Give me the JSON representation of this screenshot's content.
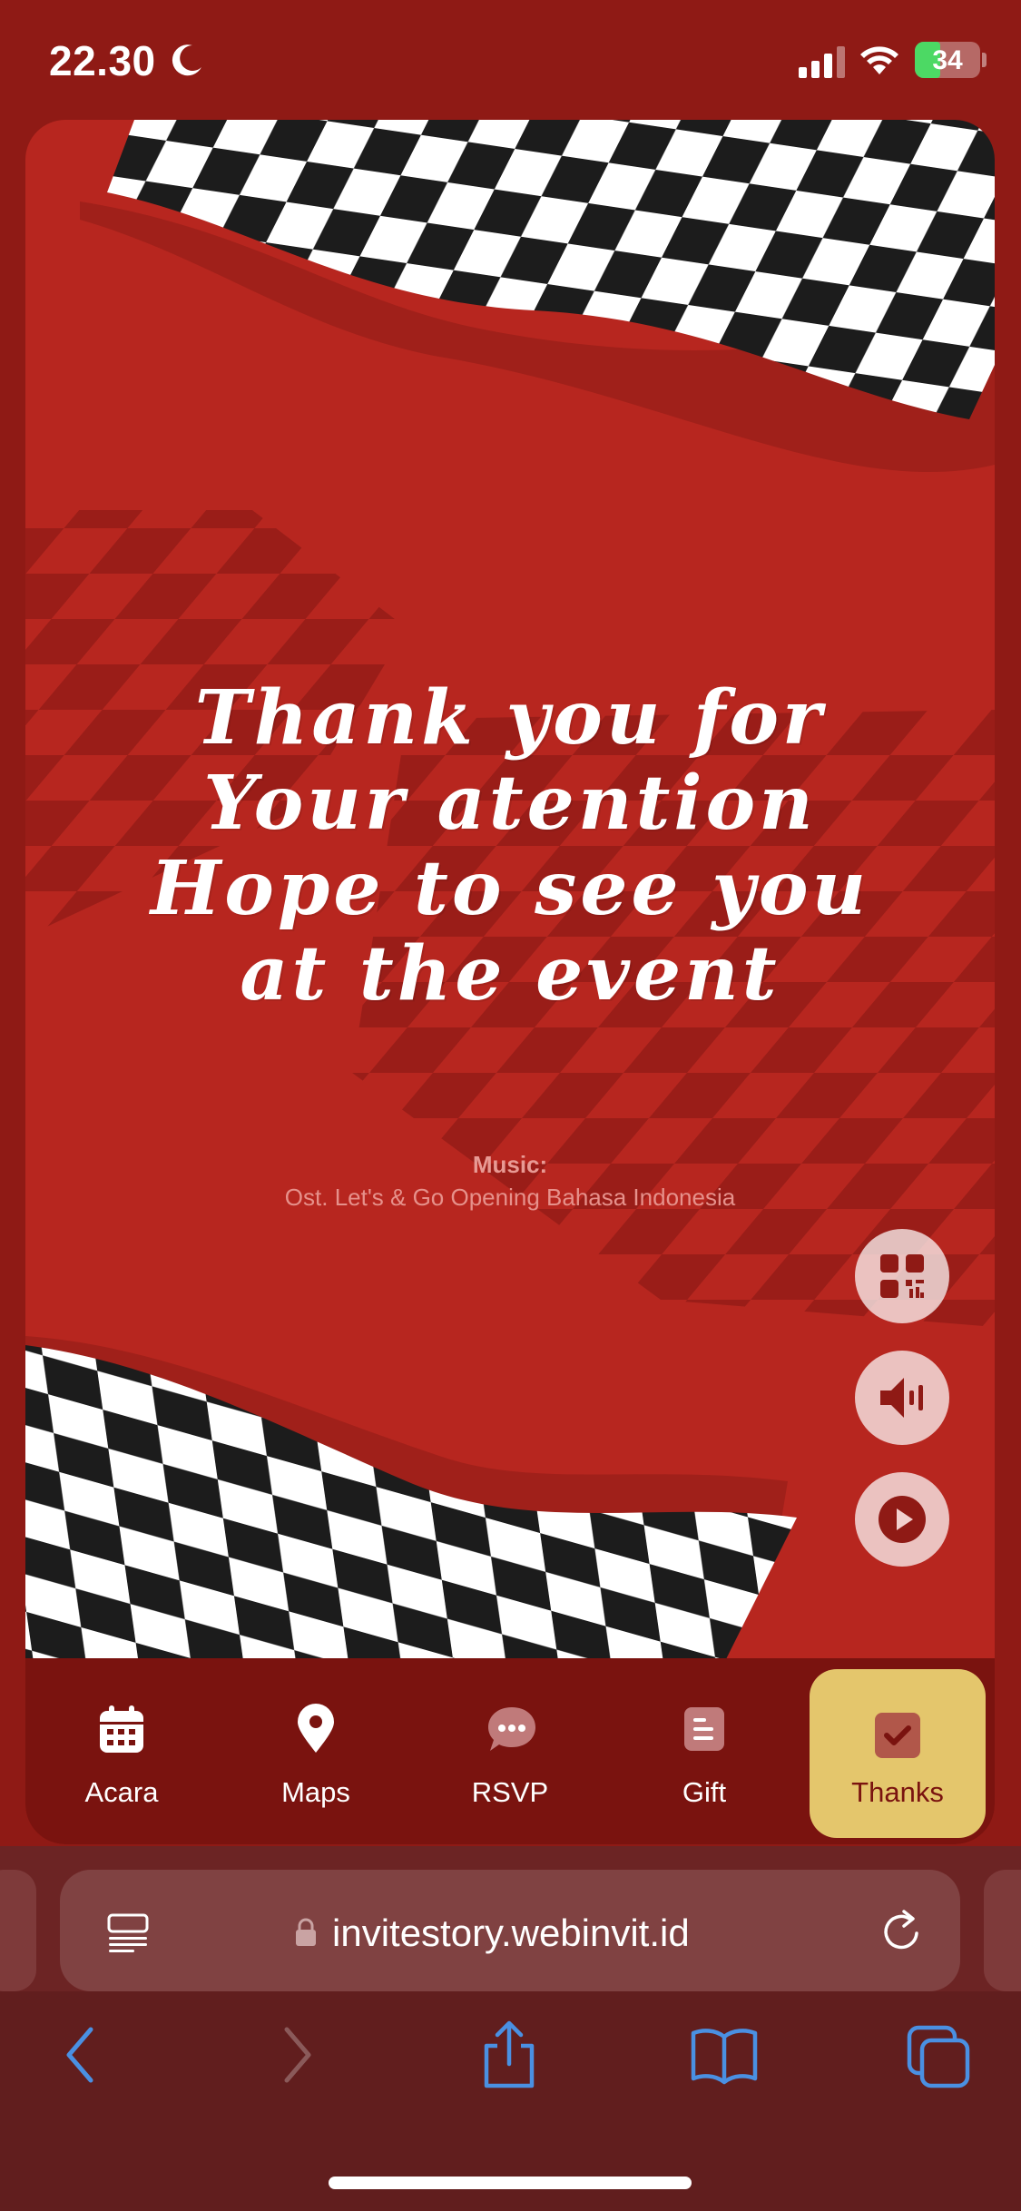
{
  "status_bar": {
    "time": "22.30",
    "battery": "34"
  },
  "invitation": {
    "message_lines": [
      "Thank you for",
      "Your atention",
      "Hope to see you",
      "at the event"
    ],
    "music_label": "Music:",
    "music_title": "Ost. Let's & Go Opening Bahasa Indonesia"
  },
  "bottom_nav": [
    {
      "label": "Acara",
      "icon": "calendar-icon"
    },
    {
      "label": "Maps",
      "icon": "map-pin-icon"
    },
    {
      "label": "RSVP",
      "icon": "chat-bubble-icon"
    },
    {
      "label": "Gift",
      "icon": "gift-list-icon"
    },
    {
      "label": "Thanks",
      "icon": "check-icon",
      "active": true
    }
  ],
  "floating_buttons": [
    "qr-code-icon",
    "speaker-icon",
    "play-icon"
  ],
  "browser": {
    "url": "invitestory.webinvit.id"
  },
  "colors": {
    "background": "#8f1a15",
    "card": "#b7261f",
    "nav": "#7a130f",
    "active_tab": "#e4c66c",
    "browser": "#611e1e"
  }
}
